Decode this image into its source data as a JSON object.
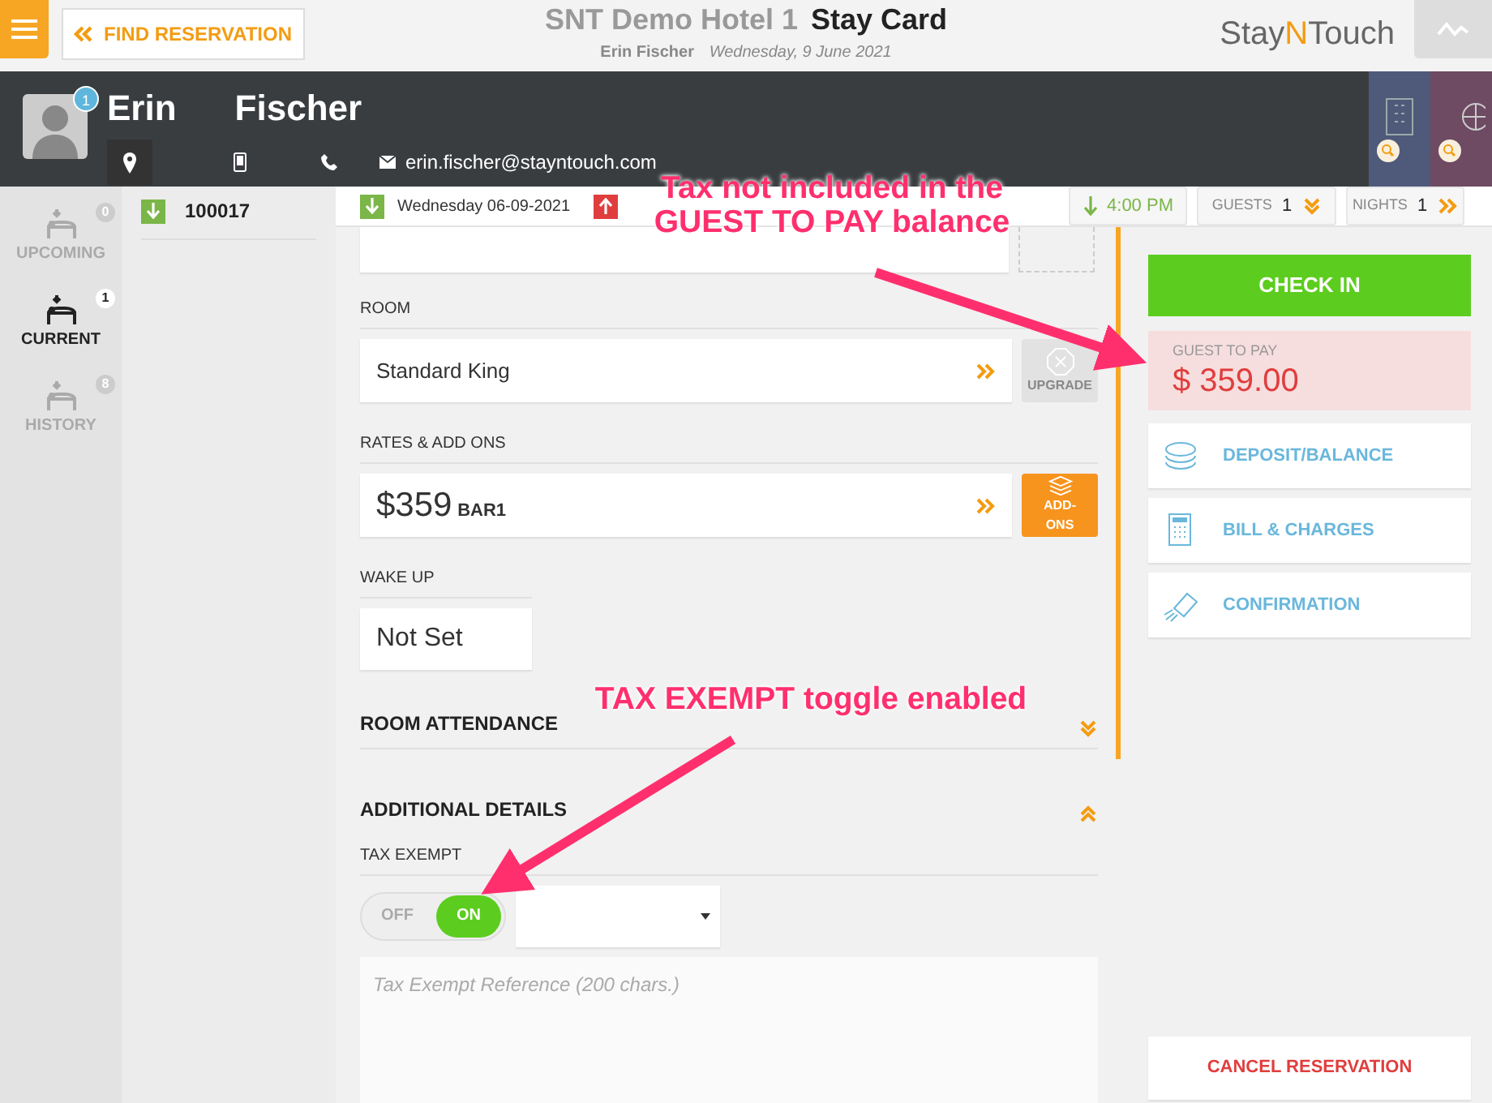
{
  "header": {
    "find_button": "FIND RESERVATION",
    "hotel": "SNT Demo Hotel 1",
    "page_title": "Stay Card",
    "guest_name": "Erin Fischer",
    "date": "Wednesday, 9 June 2021",
    "logo": [
      "Stay",
      "N",
      "Touch"
    ]
  },
  "guest": {
    "badge": "1",
    "first_name": "Erin",
    "last_name": "Fischer",
    "email": "erin.fischer@stayntouch.com"
  },
  "nav": [
    {
      "label": "UPCOMING",
      "count": "0",
      "selected": false
    },
    {
      "label": "CURRENT",
      "count": "1",
      "selected": true
    },
    {
      "label": "HISTORY",
      "count": "8",
      "selected": false
    }
  ],
  "reservations": [
    {
      "number": "100017",
      "selected": true
    }
  ],
  "stay": {
    "arrival": "Wednesday 06-09-2021",
    "time": "4:00 PM",
    "guests_label": "GUESTS",
    "guests": "1",
    "nights_label": "NIGHTS",
    "nights": "1"
  },
  "room": {
    "label": "ROOM",
    "value": "Standard King",
    "upgrade": "UPGRADE",
    "upgrade_disabled": true
  },
  "rates": {
    "label": "RATES & ADD ONS",
    "amount": "$359",
    "code": "BAR1",
    "addons": "ADD-ONS"
  },
  "wake_up": {
    "label": "WAKE UP",
    "value": "Not Set"
  },
  "room_attendance": {
    "label": "ROOM ATTENDANCE",
    "expanded": false
  },
  "additional_details": {
    "label": "ADDITIONAL DETAILS",
    "expanded": true
  },
  "tax_exempt": {
    "label": "TAX EXEMPT",
    "on": true,
    "off_label": "OFF",
    "on_label": "ON",
    "reference_placeholder": "Tax Exempt Reference (200 chars.)"
  },
  "actions": {
    "check_in": "CHECK IN",
    "balance_label": "GUEST TO PAY",
    "balance": "$ 359.00",
    "links": [
      {
        "label": "DEPOSIT/BALANCE",
        "kind": "deposit"
      },
      {
        "label": "BILL & CHARGES",
        "kind": "bill"
      },
      {
        "label": "CONFIRMATION",
        "kind": "confirmation"
      }
    ],
    "cancel": "CANCEL RESERVATION"
  },
  "annotations": [
    {
      "text": "Tax not included in the GUEST TO PAY balance"
    },
    {
      "text": "TAX EXEMPT toggle enabled"
    }
  ]
}
